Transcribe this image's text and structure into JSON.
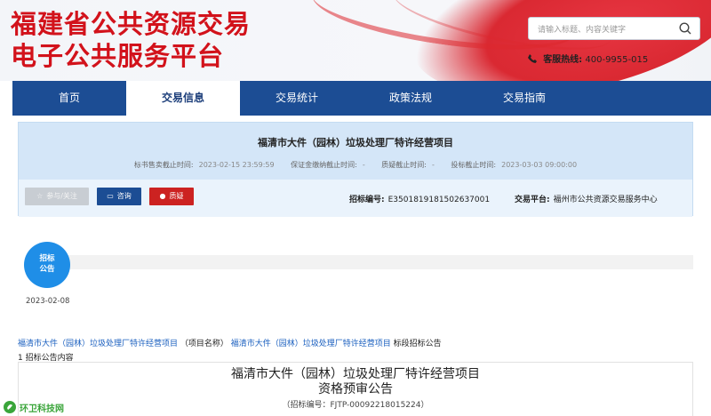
{
  "header": {
    "title_line1": "福建省公共资源交易",
    "title_line2": "电子公共服务平台",
    "search_placeholder": "请输入标题、内容关键字",
    "hotline_label": "客服热线:",
    "hotline_number": "400-9955-015"
  },
  "nav": {
    "items": [
      {
        "label": "首页"
      },
      {
        "label": "交易信息"
      },
      {
        "label": "交易统计"
      },
      {
        "label": "政策法规"
      },
      {
        "label": "交易指南"
      }
    ],
    "active": "交易信息"
  },
  "project": {
    "title": "福清市大件（园林）垃圾处理厂特许经营项目",
    "deadlines": [
      {
        "label": "标书售卖截止时间:",
        "value": "2023-02-15 23:59:59"
      },
      {
        "label": "保证金缴纳截止时间:",
        "value": "-"
      },
      {
        "label": "质疑截止时间:",
        "value": "-"
      },
      {
        "label": "投标截止时间:",
        "value": "2023-03-03 09:00:00"
      }
    ],
    "buttons": {
      "follow": "参与/关注",
      "consult": "咨询",
      "query": "质疑"
    },
    "code_label": "招标编号:",
    "code_value": "E3501819181502637001",
    "platform_label": "交易平台:",
    "platform_value": "福州市公共资源交易服务中心"
  },
  "timeline": {
    "node_line1": "招标",
    "node_line2": "公告",
    "date": "2023-02-08"
  },
  "breadcrumb": {
    "link1": "福清市大件（园林）垃圾处理厂特许经营项目",
    "middle": "（项目名称）",
    "link2": "福清市大件（园林）垃圾处理厂特许经营项目",
    "suffix": "标段招标公告"
  },
  "content_count": "1 招标公告内容",
  "document": {
    "title_line1": "福清市大件（园林）垃圾处理厂特许经营项目",
    "title_line2": "资格预审公告",
    "code_line": "（招标编号：FJTP-00092218015224）"
  },
  "watermark": {
    "text": "环卫科技网"
  },
  "colors": {
    "brand_red": "#d2121b",
    "nav_blue": "#1c4d94",
    "panel_blue": "#d4e6f8",
    "timeline_blue": "#1f8ee7",
    "link_blue": "#1a5fbf"
  }
}
